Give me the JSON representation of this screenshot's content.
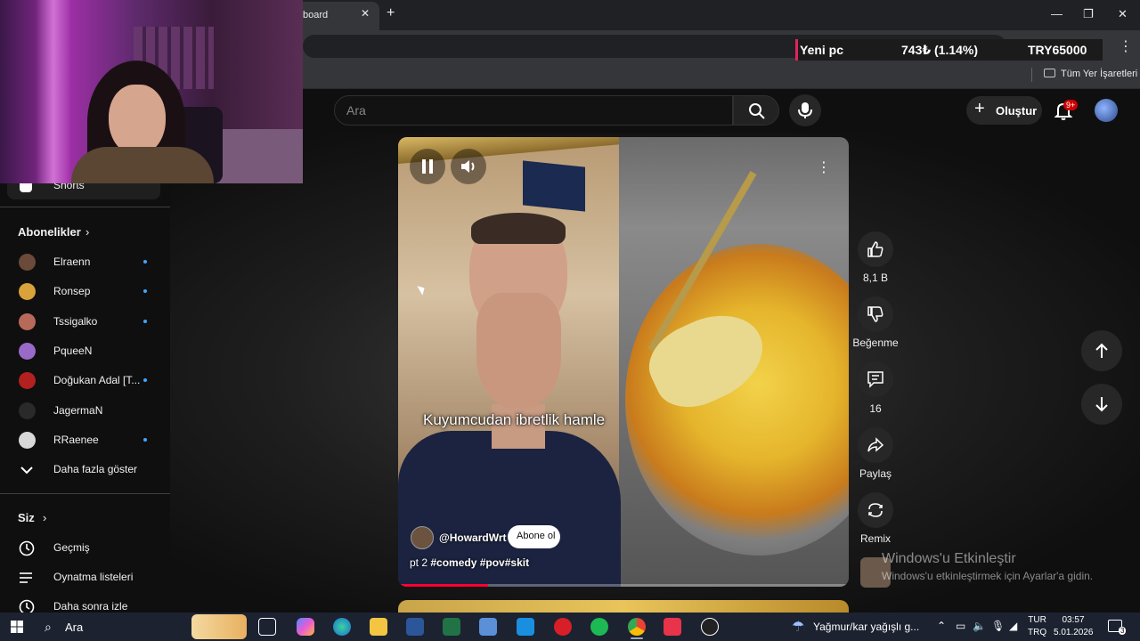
{
  "browser": {
    "tab_title": "board",
    "tab_close": "✕",
    "new_tab": "+",
    "min": "—",
    "max": "❐",
    "close": "✕",
    "bookmarks_label": "Tüm Yer İşaretleri",
    "ticker": {
      "label": "Yeni pc",
      "amount": "743₺ (1.14%)",
      "goal": "TRY65000"
    }
  },
  "masthead": {
    "search_placeholder": "Ara",
    "create_label": "Oluştur",
    "notification_count": "9+"
  },
  "sidebar": {
    "shorts_label": "Shorts",
    "subscriptions_title": "Abonelikler",
    "subscriptions": [
      {
        "name": "Elraenn",
        "new": true,
        "color": "#6b4a3a"
      },
      {
        "name": "Ronsep",
        "new": true,
        "color": "#d9a23a"
      },
      {
        "name": "Tssigalko",
        "new": true,
        "color": "#b86a5a"
      },
      {
        "name": "PqueeN",
        "new": false,
        "color": "#9a6ac8"
      },
      {
        "name": "Doğukan Adal [T...",
        "new": true,
        "color": "#b32020"
      },
      {
        "name": "JagermaN",
        "new": false,
        "color": "#2a2a2a"
      },
      {
        "name": "RRaenee",
        "new": true,
        "color": "#d8d8d8"
      }
    ],
    "show_more": "Daha fazla göster",
    "you_title": "Siz",
    "you_items": [
      "Geçmiş",
      "Oynatma listeleri",
      "Daha sonra izle"
    ]
  },
  "short": {
    "caption": "Kuyumcudan ibretlik hamle",
    "channel": "@HowardWrt",
    "subscribe": "Abone ol",
    "description_prefix": "pt 2",
    "hashtags": "#comedy #pov#skit",
    "progress": 0.2
  },
  "actions": {
    "likes": "8,1 B",
    "dislike": "Beğenme",
    "comments": "16",
    "share": "Paylaş",
    "remix": "Remix"
  },
  "watermark": {
    "title": "Windows'u Etkinleştir",
    "subtitle": "Windows'u etkinleştirmek için Ayarlar'a gidin."
  },
  "taskbar": {
    "search": "Ara",
    "weather": "Yağmur/kar yağışlı g...",
    "lang_top": "TUR",
    "lang_bottom": "TRQ",
    "time": "03:57",
    "date": "5.01.2026",
    "notifications": "3"
  }
}
